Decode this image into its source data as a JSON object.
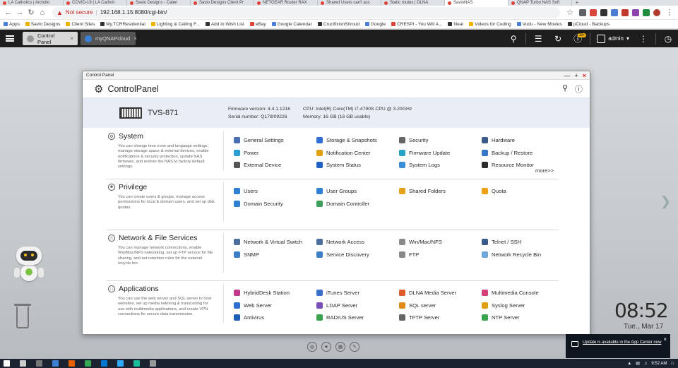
{
  "browser": {
    "tabs": [
      {
        "title": "LA Catholics | Archdio"
      },
      {
        "title": "COVID-19 | LA Catholi"
      },
      {
        "title": "Savio Designs - Calen"
      },
      {
        "title": "Savio Designs Client Pr"
      },
      {
        "title": "NETGEAR Router RAX"
      },
      {
        "title": "Shared Users can't acc"
      },
      {
        "title": "Static routes | DLNA"
      },
      {
        "title": "SavioNAS"
      },
      {
        "title": "QNAP Turbo NAS Soft"
      }
    ],
    "new_tab": "+",
    "security_label": "Not secure",
    "url": "192.168.1.15:8080/cgi-bin/",
    "bookmarks": [
      {
        "label": "Apps",
        "color": "#4a7fd4"
      },
      {
        "label": "Savio Designs",
        "color": "#f0b400"
      },
      {
        "label": "Client Sites",
        "color": "#f0b400"
      },
      {
        "label": "My.TCRResidential",
        "color": "#333333"
      },
      {
        "label": "Lighting & Ceiling F...",
        "color": "#f0b400"
      },
      {
        "label": "Add to Wish List",
        "color": "#333333"
      },
      {
        "label": "eBay",
        "color": "#d9453a"
      },
      {
        "label": "Google Calendar",
        "color": "#4a7fd4"
      },
      {
        "label": "CrucifixionShroud",
        "color": "#333333"
      },
      {
        "label": "Google",
        "color": "#4a7fd4"
      },
      {
        "label": "CRESPI - You Will A...",
        "color": "#d9453a"
      },
      {
        "label": "Neat",
        "color": "#333333"
      },
      {
        "label": "Videos for Coding",
        "color": "#f0b400"
      },
      {
        "label": "Vudu - New Movies",
        "color": "#4a7fd4"
      },
      {
        "label": "pCloud - Backups",
        "color": "#333333"
      }
    ]
  },
  "qts": {
    "tabs": [
      {
        "label": "Control Panel",
        "close": "×"
      },
      {
        "label": "myQNAPcloud",
        "close": "×"
      }
    ],
    "notification_badge": "10+",
    "user": "admin"
  },
  "window": {
    "titlebar": "Control Panel",
    "controls": {
      "min": "—",
      "max": "+",
      "close": "×"
    },
    "title_part1": "Control",
    "title_part2": "Panel",
    "model": "TVS-871",
    "firmware_label": "Firmware version:",
    "firmware": "4.4.1.1216",
    "serial_label": "Serial number:",
    "serial": "Q178I09226",
    "cpu_label": "CPU:",
    "cpu": "Intel(R) Core(TM) i7-4790S CPU @ 3.20GHz",
    "memory_label": "Memory:",
    "memory": "16 GB (16 GB usable)"
  },
  "sections": [
    {
      "title": "System",
      "desc": "You can change time zone and language settings, manage storage space & external devices, enable notifications & security protection, update NAS firmware, and restore the NAS to factory default settings.",
      "more": "more>>",
      "items": [
        {
          "label": "General Settings",
          "icon": "general-settings-icon",
          "color": "#4a6fb5"
        },
        {
          "label": "Storage & Snapshots",
          "icon": "storage-icon",
          "color": "#2f6fd1"
        },
        {
          "label": "Security",
          "icon": "security-icon",
          "color": "#666666"
        },
        {
          "label": "Hardware",
          "icon": "hardware-icon",
          "color": "#3c5a8a"
        },
        {
          "label": "Power",
          "icon": "power-icon",
          "color": "#2a9fd6"
        },
        {
          "label": "Notification Center",
          "icon": "notification-icon",
          "color": "#e0a010"
        },
        {
          "label": "Firmware Update",
          "icon": "firmware-icon",
          "color": "#2aa3c9"
        },
        {
          "label": "Backup / Restore",
          "icon": "backup-icon",
          "color": "#3677c9"
        },
        {
          "label": "External Device",
          "icon": "external-device-icon",
          "color": "#555555"
        },
        {
          "label": "System Status",
          "icon": "system-status-icon",
          "color": "#1e63c4"
        },
        {
          "label": "System Logs",
          "icon": "system-logs-icon",
          "color": "#3a8fd8"
        },
        {
          "label": "Resource Monitor",
          "icon": "resource-monitor-icon",
          "color": "#2b2b2b"
        }
      ]
    },
    {
      "title": "Privilege",
      "desc": "You can create users & groups, manage access permissions for local & domain users, and set up disk quotas.",
      "more": "",
      "items": [
        {
          "label": "Users",
          "icon": "users-icon",
          "color": "#2f7fd3"
        },
        {
          "label": "User Groups",
          "icon": "user-groups-icon",
          "color": "#2f7fd3"
        },
        {
          "label": "Shared Folders",
          "icon": "shared-folders-icon",
          "color": "#e4a21a"
        },
        {
          "label": "Quota",
          "icon": "quota-icon",
          "color": "#f0a010"
        },
        {
          "label": "Domain Security",
          "icon": "domain-security-icon",
          "color": "#2f7fd3"
        },
        {
          "label": "Domain Controller",
          "icon": "domain-controller-icon",
          "color": "#3b9f5b"
        }
      ]
    },
    {
      "title": "Network & File Services",
      "desc": "You can manage network connections, enable Win/Mac/NFS networking, set up FTP service for file sharing, and set retention rules for the network recycle bin.",
      "more": "",
      "items": [
        {
          "label": "Network & Virtual Switch",
          "icon": "network-switch-icon",
          "color": "#4d6f9e"
        },
        {
          "label": "Network Access",
          "icon": "network-access-icon",
          "color": "#4d6f9e"
        },
        {
          "label": "Win/Mac/NFS",
          "icon": "win-mac-nfs-icon",
          "color": "#8a8a8a"
        },
        {
          "label": "Telnet / SSH",
          "icon": "telnet-ssh-icon",
          "color": "#3a5a8a"
        },
        {
          "label": "SNMP",
          "icon": "snmp-icon",
          "color": "#3c7fc7"
        },
        {
          "label": "Service Discovery",
          "icon": "service-discovery-icon",
          "color": "#3c7fc7"
        },
        {
          "label": "FTP",
          "icon": "ftp-icon",
          "color": "#888888"
        },
        {
          "label": "Network Recycle Bin",
          "icon": "recycle-bin-icon",
          "color": "#6fa8dc"
        }
      ]
    },
    {
      "title": "Applications",
      "desc": "You can use the web server and SQL server to host websites, set up media indexing & transcoding for use with multimedia applications, and create VPN connections for secure data transmission.",
      "more": "",
      "items": [
        {
          "label": "HybridDesk Station",
          "icon": "hybriddesk-icon",
          "color": "#c2398a"
        },
        {
          "label": "iTunes Server",
          "icon": "itunes-icon",
          "color": "#3a6fc9"
        },
        {
          "label": "DLNA Media Server",
          "icon": "dlna-icon",
          "color": "#e05a2a"
        },
        {
          "label": "Multimedia Console",
          "icon": "multimedia-icon",
          "color": "#d6407a"
        },
        {
          "label": "Web Server",
          "icon": "web-server-icon",
          "color": "#2f6fd1"
        },
        {
          "label": "LDAP Server",
          "icon": "ldap-icon",
          "color": "#7a4fb5"
        },
        {
          "label": "SQL server",
          "icon": "sql-icon",
          "color": "#e08a1a"
        },
        {
          "label": "Syslog Server",
          "icon": "syslog-icon",
          "color": "#e0a010"
        },
        {
          "label": "Antivirus",
          "icon": "antivirus-icon",
          "color": "#1e5fb5"
        },
        {
          "label": "RADIUS Server",
          "icon": "radius-icon",
          "color": "#3aa34e"
        },
        {
          "label": "TFTP Server",
          "icon": "tftp-icon",
          "color": "#666666"
        },
        {
          "label": "NTP Server",
          "icon": "ntp-icon",
          "color": "#3aa34e"
        }
      ]
    }
  ],
  "desktop": {
    "time": "08:52",
    "date": "Tue., Mar 17"
  },
  "notification": {
    "text": "Update is available in the App Center now",
    "close": "×"
  },
  "taskbar": {
    "time": "9:52 AM"
  }
}
